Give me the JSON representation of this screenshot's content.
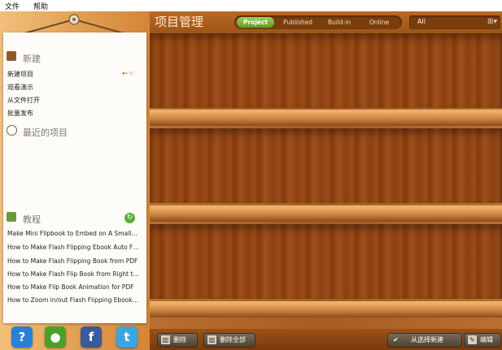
{
  "menu": {
    "file": "文件",
    "help": "帮助"
  },
  "header": {
    "title": "项目管理",
    "tabs": [
      {
        "label": "Project",
        "active": true
      },
      {
        "label": "Published",
        "active": false
      },
      {
        "label": "Build-in",
        "active": false
      },
      {
        "label": "Online",
        "active": false
      }
    ],
    "filter_value": "All"
  },
  "sidebar": {
    "new_section": "新建",
    "new_items": [
      "新建项目",
      "观看演示",
      "从文件打开",
      "批量发布"
    ],
    "recent_section": "最近的项目",
    "tutorial_section": "教程",
    "tutorials": [
      "Make Mini Flipbook to Embed on A Small Ar...",
      "How to Make Flash Flipping Ebook Auto Flip?",
      "How to Make Flash Flipping Book from PDF",
      "How to Make Flash Flip Book from Right to ...",
      "How to Make Flip Book Animation for PDF",
      "How to Zoom in/out Flash Flipping Ebook wi..."
    ]
  },
  "social": [
    {
      "icon": "help-icon",
      "glyph": "?",
      "color": "#2b7fd6"
    },
    {
      "icon": "community-icon",
      "glyph": "●",
      "color": "#4aa02a"
    },
    {
      "icon": "facebook-icon",
      "glyph": "f",
      "color": "#3b5a9a"
    },
    {
      "icon": "twitter-icon",
      "glyph": "t",
      "color": "#3aa5e0"
    }
  ],
  "bottom": {
    "delete": "删除",
    "delete_all": "删除全部",
    "create_from_template": "从选择新建",
    "edit": "编辑"
  },
  "colors": {
    "active_tab": "#6aa82e",
    "wood": "#9a4c18"
  }
}
